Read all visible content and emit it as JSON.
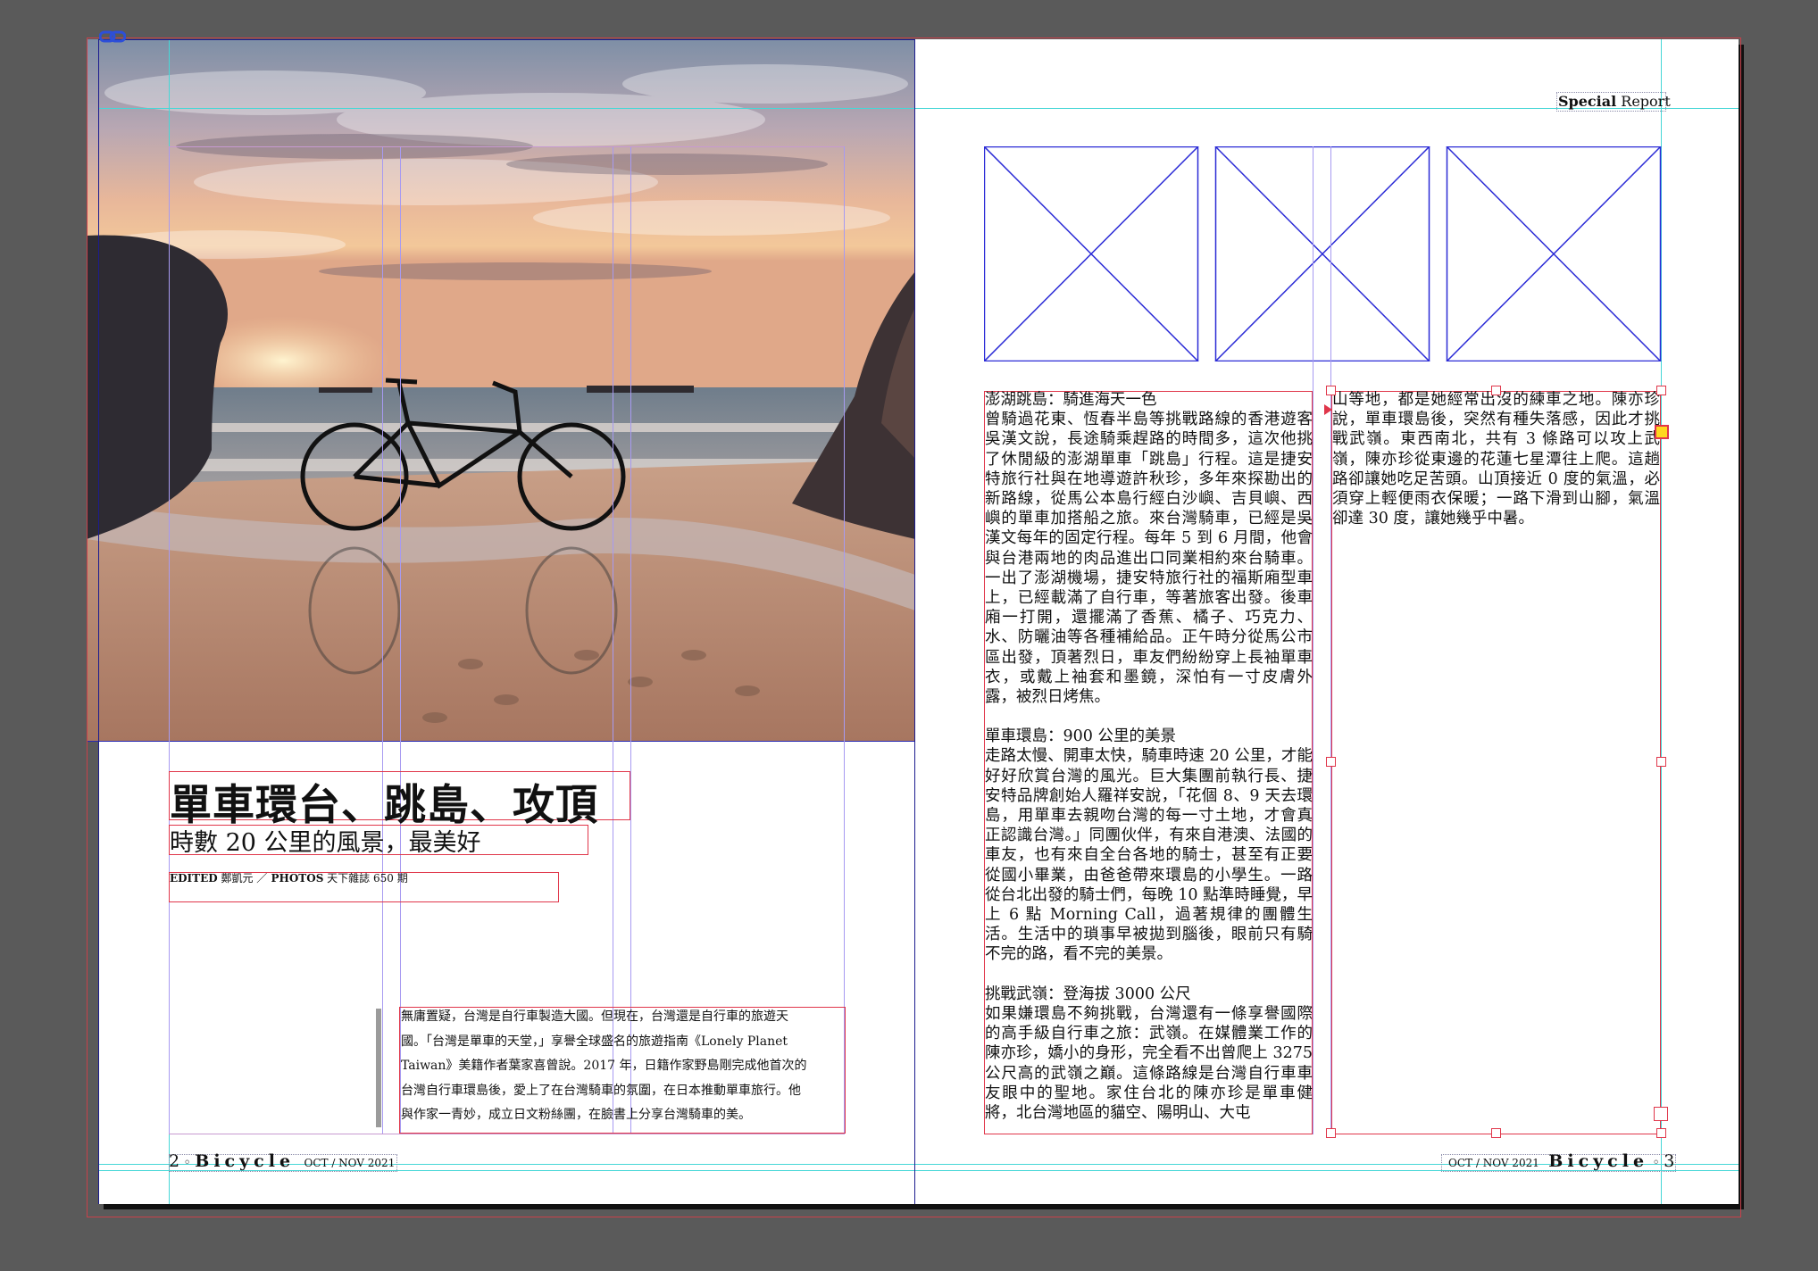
{
  "header": {
    "special_bold": "Special",
    "special_rest": " Report"
  },
  "left_page": {
    "title": "單車環台、跳島、攻頂",
    "subtitle": "時數 20 公里的風景，最美好",
    "credits": {
      "edited_label": "EDITED",
      "edited_name": " 鄭凱元 ",
      "separator": "／",
      "photos_label": " PHOTOS",
      "photos_source": " 天下雜誌 650 期"
    },
    "intro_lines": [
      "無庸置疑，台灣是自行車製造大國。但現在，台灣還是自行車的旅遊天",
      "國。「台灣是單車的天堂，」享譽全球盛名的旅遊指南《Lonely Planet",
      "Taiwan》美籍作者葉家喜曾說。2017 年，日籍作家野島剛完成他首次的",
      "台灣自行車環島後，愛上了在台灣騎車的氛圍，在日本推動單車旅行。他",
      "與作家一青妙，成立日文粉絲團，在臉書上分享台灣騎車的美。"
    ],
    "folio": {
      "number": "2",
      "dot": " ◦ ",
      "brand": "Bicycle",
      "issue": "OCT / NOV 2021"
    }
  },
  "right_page": {
    "col1": [
      "澎湖跳島：騎進海天一色",
      "曾騎過花東、恆春半島等挑戰路線的香港遊客吳漢文說，長途騎乘趕路的時間多，這次他挑了休閒級的澎湖單車「跳島」行程。這是捷安特旅行社與在地導遊許秋珍，多年來探勘出的新路線，從馬公本島行經白沙嶼、吉貝嶼、西嶼的單車加搭船之旅。來台灣騎車，已經是吳漢文每年的固定行程。每年 5 到 6 月間，他會與台港兩地的肉品進出口同業相約來台騎車。一出了澎湖機場，捷安特旅行社的福斯廂型車上，已經載滿了自行車，等著旅客出發。後車廂一打開，還擺滿了香蕉、橘子、巧克力、水、防曬油等各種補給品。正午時分從馬公市區出發，頂著烈日，車友們紛紛穿上長袖單車衣，或戴上袖套和墨鏡，深怕有一寸皮膚外露，被烈日烤焦。",
      "",
      "單車環島：900 公里的美景",
      "走路太慢、開車太快，騎車時速 20 公里，才能好好欣賞台灣的風光。巨大集團前執行長、捷安特品牌創始人羅祥安說，「花個 8、9 天去環島，用單車去親吻台灣的每一寸土地，才會真正認識台灣。」同團伙伴，有來自港澳、法國的車友，也有來自全台各地的騎士，甚至有正要從國小畢業，由爸爸帶來環島的小學生。一路從台北出發的騎士們，每晚 10 點準時睡覺，早上 6 點 Morning Call，過著規律的團體生活。生活中的瑣事早被拋到腦後，眼前只有騎不完的路，看不完的美景。",
      "",
      "挑戰武嶺：登海拔 3000 公尺",
      "如果嫌環島不夠挑戰，台灣還有一條享譽國際的高手級自行車之旅：武嶺。在媒體業工作的陳亦珍，嬌小的身形，完全看不出曾爬上 3275 公尺高的武嶺之巔。這條路線是台灣自行車車友眼中的聖地。家住台北的陳亦珍是單車健將，北台灣地區的貓空、陽明山、大屯"
    ],
    "col2": "山等地，都是她經常出沒的練車之地。陳亦珍說，單車環島後，突然有種失落感，因此才挑戰武嶺。東西南北，共有 3 條路可以攻上武嶺，陳亦珍從東邊的花蓮七星潭往上爬。這趟路卻讓她吃足苦頭。山頂接近 0 度的氣溫，必須穿上輕便雨衣保暖；一路下滑到山腳，氣溫卻達 30 度，讓她幾乎中暑。",
    "folio": {
      "issue": "OCT / NOV 2021",
      "brand": "Bicycle",
      "dot": " ◦ ",
      "number": "3"
    }
  },
  "colors": {
    "frame": "#e0364a",
    "guide": "#46d7d7",
    "column": "#a79af1",
    "placeholder": "#2b2bd6",
    "pasteboard": "#5a5a5a"
  },
  "icons": {
    "link": "chain-link-icon",
    "overflow": "text-overflow-icon"
  }
}
